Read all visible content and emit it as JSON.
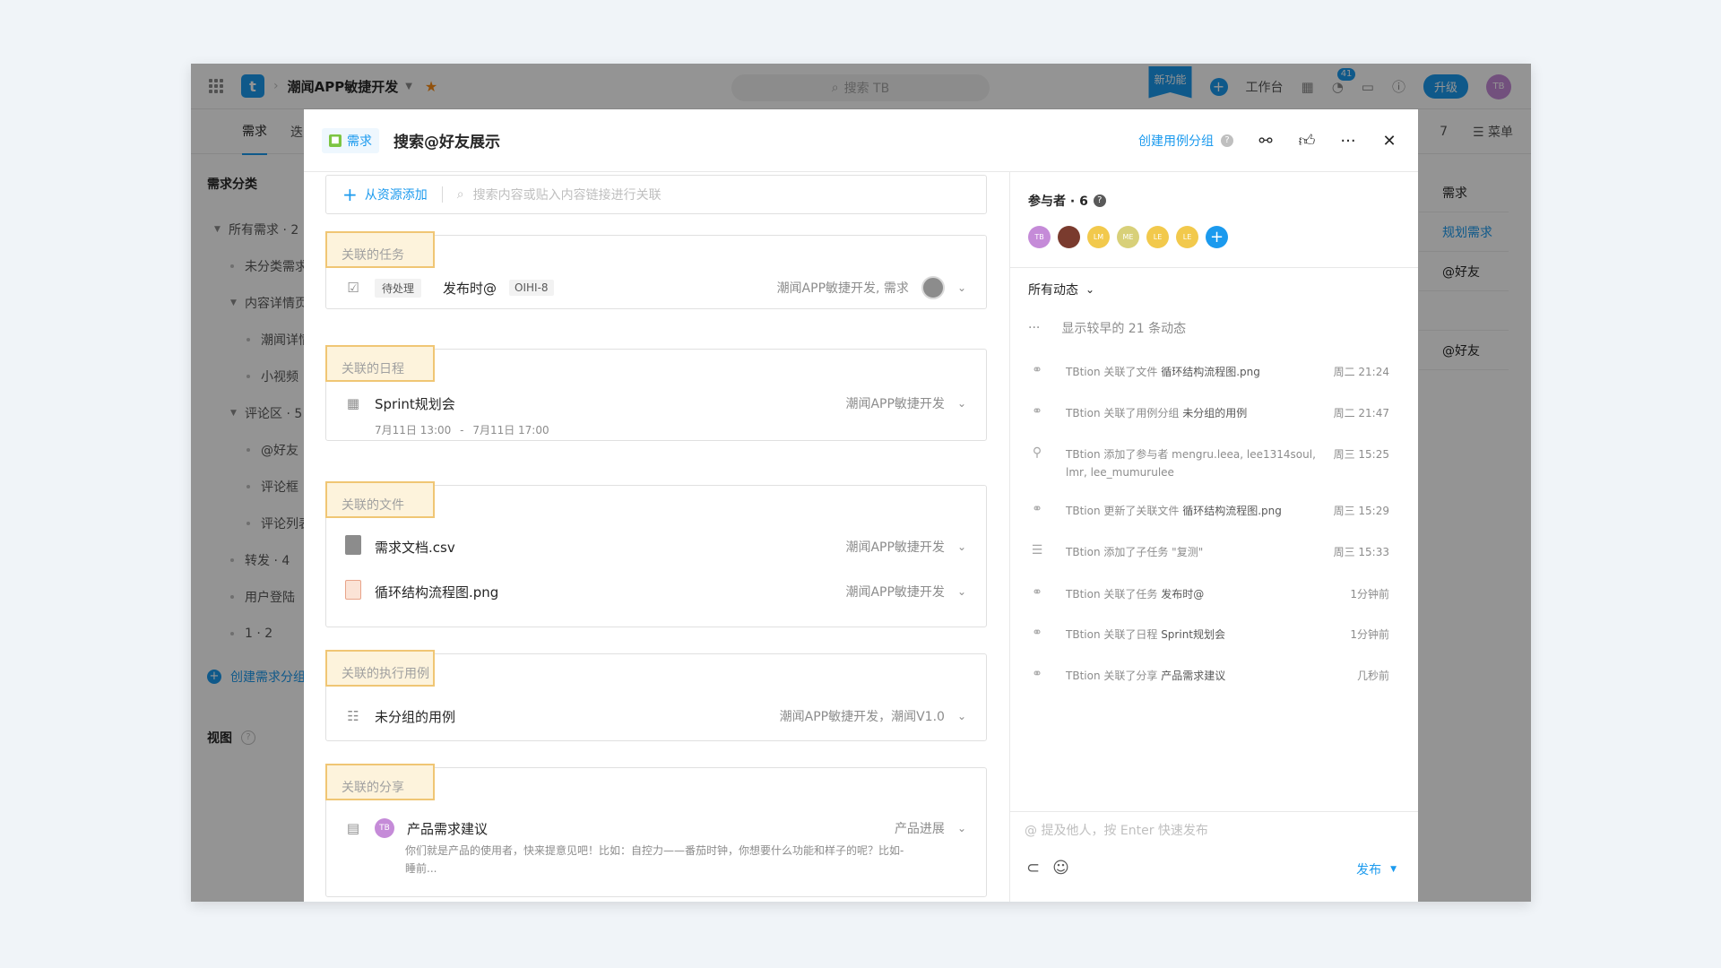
{
  "topbar": {
    "project_name": "潮闻APP敏捷开发",
    "search_placeholder": "搜索 TB",
    "new_feature": "新功能",
    "workbench": "工作台",
    "notif_count": "41",
    "upgrade": "升级",
    "avatar": "TB"
  },
  "subnav": {
    "active_tab": "需求",
    "tab2": "迭",
    "right_count": "7",
    "menu": "菜单"
  },
  "sidebar": {
    "title": "需求分类",
    "items": [
      {
        "label": "所有需求 · 2",
        "indent": 0,
        "kind": "tri"
      },
      {
        "label": "未分类需求",
        "indent": 1,
        "kind": "dot"
      },
      {
        "label": "内容详情页",
        "indent": 1,
        "kind": "tri"
      },
      {
        "label": "潮闻详情",
        "indent": 2,
        "kind": "dot"
      },
      {
        "label": "小视频",
        "indent": 2,
        "kind": "dot"
      },
      {
        "label": "评论区 · 5",
        "indent": 1,
        "kind": "tri"
      },
      {
        "label": "@好友",
        "indent": 2,
        "kind": "dot"
      },
      {
        "label": "评论框",
        "indent": 2,
        "kind": "dot"
      },
      {
        "label": "评论列表",
        "indent": 2,
        "kind": "dot"
      },
      {
        "label": "转发 · 4",
        "indent": 1,
        "kind": "dot"
      },
      {
        "label": "用户登陆",
        "indent": 1,
        "kind": "dot"
      },
      {
        "label": "1 · 2",
        "indent": 1,
        "kind": "dot"
      }
    ],
    "create": "创建需求分组",
    "view": "视图"
  },
  "bg_right": {
    "col1": "需求",
    "plan": "规划需求",
    "row1": "@好友",
    "row2": "@好友"
  },
  "modal": {
    "type_label": "需求",
    "title": "搜索@好友展示",
    "create_group": "创建用例分组",
    "link_add": "从资源添加",
    "link_search_placeholder": "搜索内容或贴入内容链接进行关联",
    "tasks": {
      "label": "关联的任务",
      "status": "待处理",
      "title": "发布时@",
      "code": "OIHI-8",
      "project": "潮闻APP敏捷开发, 需求"
    },
    "schedule": {
      "label": "关联的日程",
      "title": "Sprint规划会",
      "time_start": "7月11日 13:00",
      "time_sep": "-",
      "time_end": "7月11日 17:00",
      "project": "潮闻APP敏捷开发"
    },
    "files": {
      "label": "关联的文件",
      "items": [
        {
          "name": "需求文档.csv",
          "project": "潮闻APP敏捷开发"
        },
        {
          "name": "循环结构流程图.png",
          "project": "潮闻APP敏捷开发"
        }
      ]
    },
    "cases": {
      "label": "关联的执行用例",
      "title": "未分组的用例",
      "project": "潮闻APP敏捷开发，潮闻V1.0"
    },
    "shares": {
      "label": "关联的分享",
      "avatar": "TB",
      "title": "产品需求建议",
      "project": "产品进展",
      "desc1": "你们就是产品的使用者，快来提意见吧！比如：自控力——番茄时钟，你想要什么功能和样子的呢？比如-",
      "desc2": "睡前..."
    }
  },
  "panel": {
    "participants_label": "参与者 · 6",
    "participants": [
      {
        "initials": "TB",
        "color": "#c58bd8"
      },
      {
        "initials": "",
        "color": "#7a3b2e"
      },
      {
        "initials": "LM",
        "color": "#f2c94c"
      },
      {
        "initials": "ME",
        "color": "#d8d079"
      },
      {
        "initials": "LE",
        "color": "#f2c94c"
      },
      {
        "initials": "LE",
        "color": "#f2c94c"
      }
    ],
    "filter": "所有动态",
    "show_more": "显示较早的 21 条动态",
    "activities": [
      {
        "icon": "link-icon",
        "glyph": "⚭",
        "text": "TBtion 关联了文件 ",
        "target": "循环结构流程图.png",
        "time": "周二 21:24"
      },
      {
        "icon": "link-icon",
        "glyph": "⚭",
        "text": "TBtion 关联了用例分组 ",
        "target": "未分组的用例",
        "time": "周二 21:47"
      },
      {
        "icon": "person-icon",
        "glyph": "⚲",
        "text": "TBtion 添加了参与者 mengru.leea, lee1314soul, lmr, lee_mumurulee",
        "target": "",
        "time": "周三 15:25"
      },
      {
        "icon": "link-icon",
        "glyph": "⚭",
        "text": "TBtion 更新了关联文件 ",
        "target": "循环结构流程图.png",
        "time": "周三 15:29"
      },
      {
        "icon": "list-icon",
        "glyph": "☰",
        "text": "TBtion 添加了子任务 \"复测\"",
        "target": "",
        "time": "周三 15:33"
      },
      {
        "icon": "link-icon",
        "glyph": "⚭",
        "text": "TBtion 关联了任务 ",
        "target": "发布时@",
        "time": "1分钟前"
      },
      {
        "icon": "link-icon",
        "glyph": "⚭",
        "text": "TBtion 关联了日程 ",
        "target": "Sprint规划会",
        "time": "1分钟前"
      },
      {
        "icon": "link-icon",
        "glyph": "⚭",
        "text": "TBtion 关联了分享 ",
        "target": "产品需求建议",
        "time": "几秒前"
      }
    ],
    "comment_placeholder": "@ 提及他人，按 Enter 快速发布",
    "publish": "发布"
  }
}
